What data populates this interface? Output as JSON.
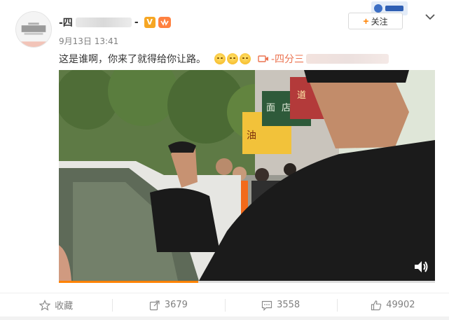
{
  "post": {
    "username_prefix": "-四",
    "username_suffix": "-",
    "badge_label": "V",
    "timestamp": "9月13日 13:41",
    "follow_label": "关注",
    "follow_plus": "+",
    "text": "这是谁啊，你来了就得给你让路。",
    "video_link_label": "-四分三"
  },
  "video": {
    "progress_fraction": 0.37,
    "signs": [
      "油",
      "面",
      "店",
      "道"
    ]
  },
  "footer": {
    "favorite_label": "收藏",
    "share_count": "3679",
    "comment_count": "3558",
    "like_count": "49902"
  },
  "icons": {
    "favorite": "star-outline-icon",
    "share": "share-icon",
    "comment": "comment-icon",
    "like": "thumbs-up-icon",
    "volume": "volume-icon",
    "chevron": "chevron-down-icon",
    "video_link": "video-camera-icon"
  },
  "colors": {
    "accent": "#ff8200",
    "link": "#eb7350",
    "muted": "#808080"
  }
}
